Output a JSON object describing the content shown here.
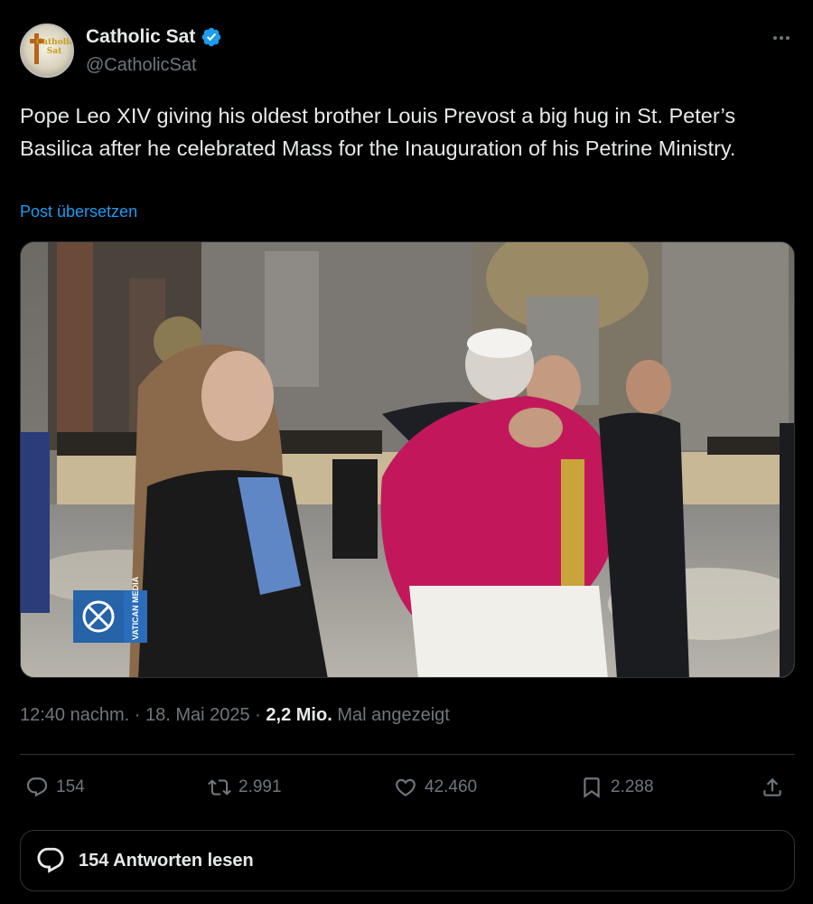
{
  "author": {
    "name": "Catholic Sat",
    "handle": "@CatholicSat",
    "avatar_text": "Catholic Sat",
    "verified": true
  },
  "tweet": {
    "text": "Pope Leo XIV giving his oldest brother Louis Prevost a big hug in St. Peter’s Basilica after he celebrated Mass for the Inauguration of his Petrine Ministry.",
    "translate_label": "Post übersetzen"
  },
  "media": {
    "watermark": "VATICAN MEDIA"
  },
  "meta": {
    "time": "12:40 nachm.",
    "separator": " · ",
    "date": "18. Mai 2025",
    "views_count": "2,2 Mio.",
    "views_label": "Mal angezeigt"
  },
  "actions": {
    "replies": "154",
    "reposts": "2.991",
    "likes": "42.460",
    "bookmarks": "2.288"
  },
  "replies_button": {
    "label": "154 Antworten lesen"
  },
  "colors": {
    "background": "#000000",
    "text": "#e7e9ea",
    "secondary": "#71767b",
    "accent": "#1d9bf0",
    "border": "#2f3336"
  }
}
